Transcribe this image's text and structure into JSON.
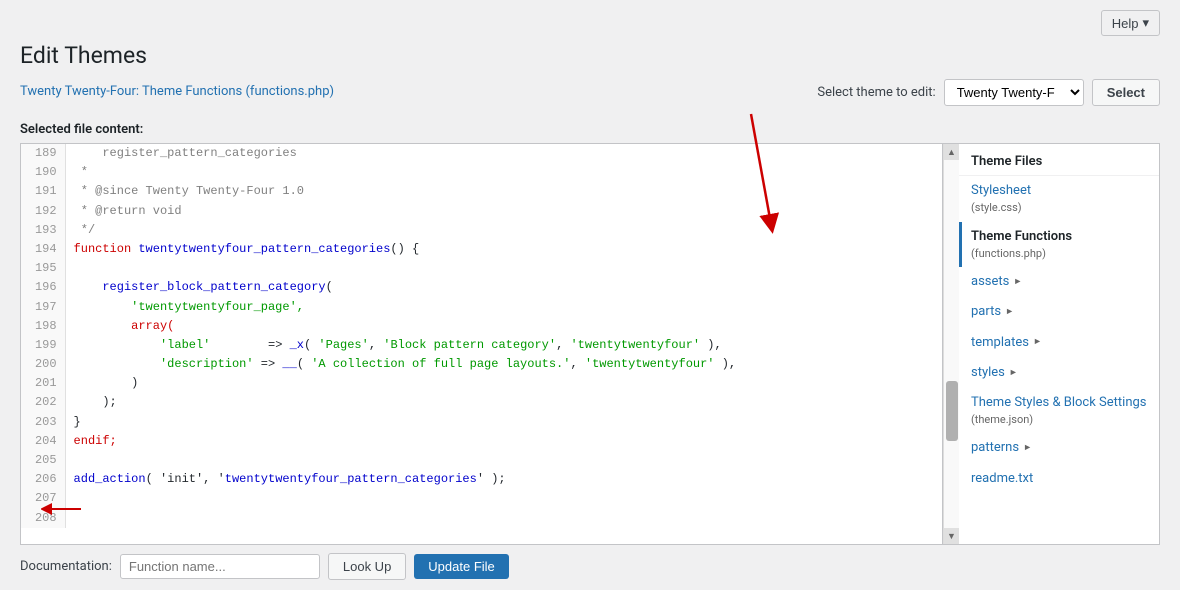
{
  "header": {
    "help_label": "Help",
    "title": "Edit Themes",
    "breadcrumb": "Twenty Twenty-Four: Theme Functions (functions.php)"
  },
  "theme_selector": {
    "label": "Select theme to edit:",
    "value": "Twenty Twenty-F",
    "button_label": "Select"
  },
  "content_label": "Selected file content:",
  "code": {
    "lines": [
      {
        "num": "189",
        "code": "    register_pattern_categories",
        "style": "comment"
      },
      {
        "num": "190",
        "code": " * ",
        "style": "comment"
      },
      {
        "num": "191",
        "code": " * @since Twenty Twenty-Four 1.0",
        "style": "comment"
      },
      {
        "num": "192",
        "code": " * @return void",
        "style": "comment"
      },
      {
        "num": "193",
        "code": " */",
        "style": "comment"
      },
      {
        "num": "194",
        "code": "function twentytwentyfour_pattern_categories() {",
        "style": "func"
      },
      {
        "num": "195",
        "code": "",
        "style": "plain"
      },
      {
        "num": "196",
        "code": "    register_block_pattern_category(",
        "style": "func"
      },
      {
        "num": "197",
        "code": "        'twentytwentyfour_page',",
        "style": "string"
      },
      {
        "num": "198",
        "code": "        array(",
        "style": "keyword"
      },
      {
        "num": "199",
        "code": "            'label'        => _x( 'Pages', 'Block pattern category', 'twentytwentyfour' ),",
        "style": "mixed"
      },
      {
        "num": "200",
        "code": "            'description' => __( 'A collection of full page layouts.', 'twentytwentyfour' ),",
        "style": "mixed"
      },
      {
        "num": "201",
        "code": "        )",
        "style": "plain"
      },
      {
        "num": "202",
        "code": "    );",
        "style": "plain"
      },
      {
        "num": "203",
        "code": "}",
        "style": "plain"
      },
      {
        "num": "204",
        "code": "endif;",
        "style": "keyword"
      },
      {
        "num": "205",
        "code": "",
        "style": "plain"
      },
      {
        "num": "206",
        "code": "add_action( 'init', 'twentytwentyfour_pattern_categories' );",
        "style": "func"
      },
      {
        "num": "207",
        "code": "",
        "style": "plain"
      },
      {
        "num": "208",
        "code": "",
        "style": "plain"
      }
    ]
  },
  "theme_files": {
    "title": "Theme Files",
    "items": [
      {
        "id": "stylesheet",
        "label": "Stylesheet",
        "sub": "(style.css)",
        "active": false,
        "folder": false
      },
      {
        "id": "theme-functions",
        "label": "Theme Functions",
        "sub": "(functions.php)",
        "active": true,
        "folder": false
      },
      {
        "id": "assets",
        "label": "assets",
        "sub": "",
        "active": false,
        "folder": true
      },
      {
        "id": "parts",
        "label": "parts",
        "sub": "",
        "active": false,
        "folder": true
      },
      {
        "id": "templates",
        "label": "templates",
        "sub": "",
        "active": false,
        "folder": true
      },
      {
        "id": "styles",
        "label": "styles",
        "sub": "",
        "active": false,
        "folder": true
      },
      {
        "id": "theme-styles",
        "label": "Theme Styles & Block Settings",
        "sub": "(theme.json)",
        "active": false,
        "folder": false
      },
      {
        "id": "patterns",
        "label": "patterns",
        "sub": "",
        "active": false,
        "folder": true
      },
      {
        "id": "readme",
        "label": "readme.txt",
        "sub": "",
        "active": false,
        "folder": false
      }
    ]
  },
  "bottom": {
    "label": "Documentation:",
    "placeholder": "Function name...",
    "lookup_label": "Look Up",
    "save_label": "Update File"
  }
}
